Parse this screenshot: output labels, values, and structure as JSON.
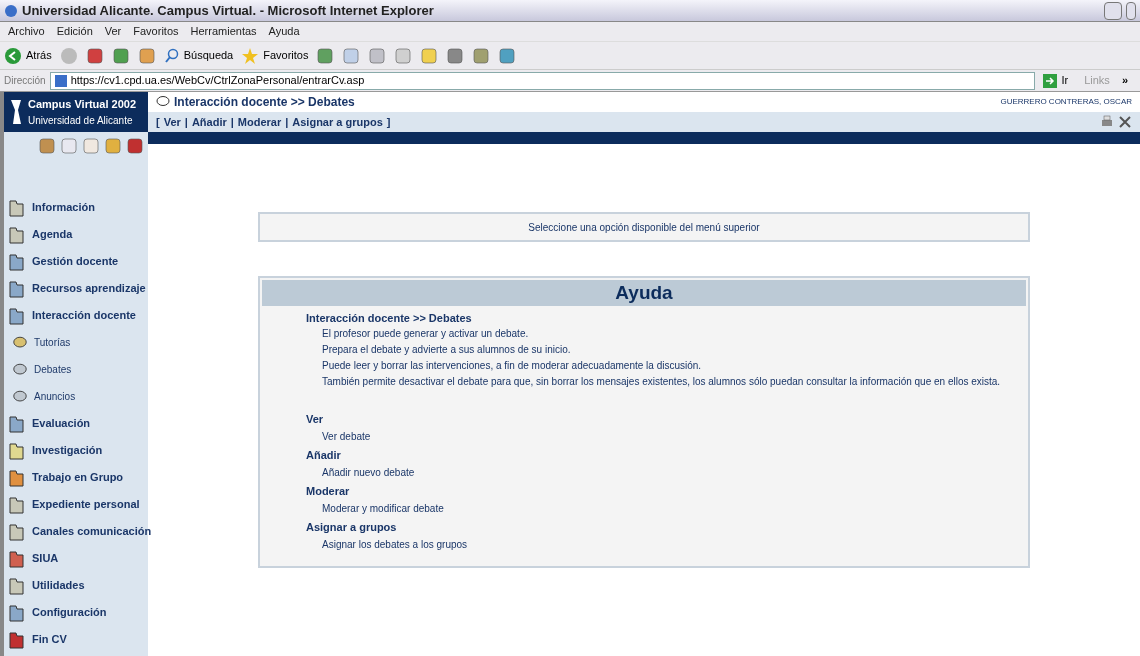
{
  "window": {
    "title": "Universidad Alicante. Campus Virtual. - Microsoft Internet Explorer"
  },
  "menu_bar": [
    "Archivo",
    "Edición",
    "Ver",
    "Favoritos",
    "Herramientas",
    "Ayuda"
  ],
  "toolbar": {
    "back": "Atrás",
    "search": "Búsqueda",
    "favorites": "Favoritos"
  },
  "address_bar": {
    "label": "Dirección",
    "value": "https://cv1.cpd.ua.es/WebCv/CtrlZonaPersonal/entrarCv.asp",
    "go": "Ir",
    "links": "Links",
    "more": "»"
  },
  "portal": {
    "brand": "Campus Virtual 2002",
    "subtitle": "Universidad de Alicante",
    "section_title": "Interacción docente >> Debates",
    "user": "GUERRERO CONTRERAS, OSCAR",
    "nav": {
      "open": "[",
      "links": [
        "Ver",
        "Añadir",
        "Moderar",
        "Asignar a grupos"
      ],
      "separators": [
        "|",
        "|",
        "|"
      ],
      "close": "]"
    }
  },
  "sidebar": {
    "items": [
      {
        "label": "Información",
        "kind": "section",
        "color": "#c8c8b8"
      },
      {
        "label": "Agenda",
        "kind": "section",
        "color": "#c8c8b8"
      },
      {
        "label": "Gestión docente",
        "kind": "section",
        "color": "#8aa8c8"
      },
      {
        "label": "Recursos aprendizaje",
        "kind": "section",
        "color": "#8aa8c8"
      },
      {
        "label": "Interacción docente",
        "kind": "section",
        "color": "#8aa8c8"
      },
      {
        "label": "Tutorías",
        "kind": "sub",
        "color": "#d8c070"
      },
      {
        "label": "Debates",
        "kind": "sub",
        "color": "#c0c8d0"
      },
      {
        "label": "Anuncios",
        "kind": "sub",
        "color": "#c0c8d0"
      },
      {
        "label": "Evaluación",
        "kind": "section",
        "color": "#8aa8c8"
      },
      {
        "label": "Investigación",
        "kind": "section",
        "color": "#e0d890"
      },
      {
        "label": "Trabajo en Grupo",
        "kind": "section",
        "color": "#e09040"
      },
      {
        "label": "Expediente personal",
        "kind": "section",
        "color": "#c8c8b8"
      },
      {
        "label": "Canales comunicación",
        "kind": "section",
        "color": "#c8c8b8"
      },
      {
        "label": "SIUA",
        "kind": "section",
        "color": "#d06050"
      },
      {
        "label": "Utilidades",
        "kind": "section",
        "color": "#c8c8b8"
      },
      {
        "label": "Configuración",
        "kind": "section",
        "color": "#8aa8c8"
      },
      {
        "label": "Fin CV",
        "kind": "section",
        "color": "#c03030"
      }
    ]
  },
  "notice": "Seleccione una opción disponible del menú superior",
  "help": {
    "title": "Ayuda",
    "heading": "Interacción docente >> Debates",
    "lines": [
      "El profesor puede generar y activar un debate.",
      "Prepara el debate y advierte a sus alumnos de su inicio.",
      "Puede leer y borrar las intervenciones, a fin de moderar adecuadamente la discusión.",
      "También permite desactivar el debate para que, sin borrar los mensajes existentes, los alumnos sólo puedan consultar la información que en ellos exista."
    ],
    "options": [
      {
        "name": "Ver",
        "description": "Ver debate"
      },
      {
        "name": "Añadir",
        "description": "Añadir nuevo debate"
      },
      {
        "name": "Moderar",
        "description": "Moderar y modificar debate"
      },
      {
        "name": "Asignar a grupos",
        "description": "Asignar los debates a los grupos"
      }
    ]
  }
}
